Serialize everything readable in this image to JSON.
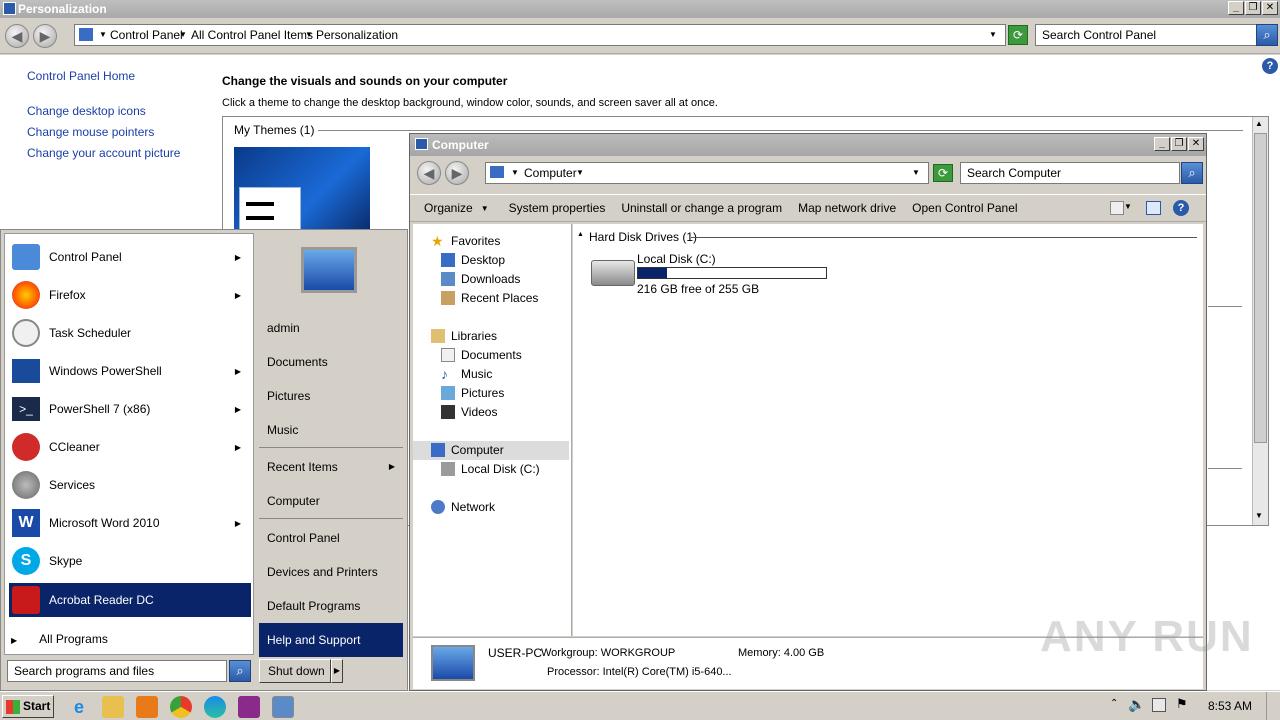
{
  "cp": {
    "title": "Personalization",
    "breadcrumb": [
      "Control Panel",
      "All Control Panel Items",
      "Personalization"
    ],
    "search_placeholder": "Search Control Panel",
    "side_links": [
      "Control Panel Home",
      "Change desktop icons",
      "Change mouse pointers",
      "Change your account picture"
    ],
    "heading": "Change the visuals and sounds on your computer",
    "subheading": "Click a theme to change the desktop background, window color, sounds, and screen saver all at once.",
    "my_themes": "My Themes (1)"
  },
  "explorer": {
    "title": "Computer",
    "address": "Computer",
    "search_placeholder": "Search Computer",
    "commands": [
      "Organize",
      "System properties",
      "Uninstall or change a program",
      "Map network drive",
      "Open Control Panel"
    ],
    "nav": {
      "favorites": "Favorites",
      "fav_items": [
        "Desktop",
        "Downloads",
        "Recent Places"
      ],
      "libraries": "Libraries",
      "lib_items": [
        "Documents",
        "Music",
        "Pictures",
        "Videos"
      ],
      "computer": "Computer",
      "computer_items": [
        "Local Disk (C:)"
      ],
      "network": "Network"
    },
    "group": "Hard Disk Drives (1)",
    "disk": {
      "name": "Local Disk (C:)",
      "free": "216 GB free of 255 GB",
      "used_fraction": 0.153
    },
    "details": {
      "pc": "USER-PC",
      "workgroup": "Workgroup: WORKGROUP",
      "memory": "Memory: 4.00 GB",
      "processor": "Processor: Intel(R) Core(TM) i5-640..."
    }
  },
  "start_menu": {
    "programs": [
      "Control Panel",
      "Firefox",
      "Task Scheduler",
      "Windows PowerShell",
      "PowerShell 7 (x86)",
      "CCleaner",
      "Services",
      "Microsoft Word 2010",
      "Skype",
      "Acrobat Reader DC"
    ],
    "all_programs": "All Programs",
    "search_placeholder": "Search programs and files",
    "right": [
      "admin",
      "Documents",
      "Pictures",
      "Music",
      "Recent Items",
      "Computer",
      "Control Panel",
      "Devices and Printers",
      "Default Programs",
      "Help and Support"
    ],
    "shutdown": "Shut down"
  },
  "taskbar": {
    "start": "Start",
    "time": "8:53 AM"
  },
  "watermark": "ANY RUN"
}
